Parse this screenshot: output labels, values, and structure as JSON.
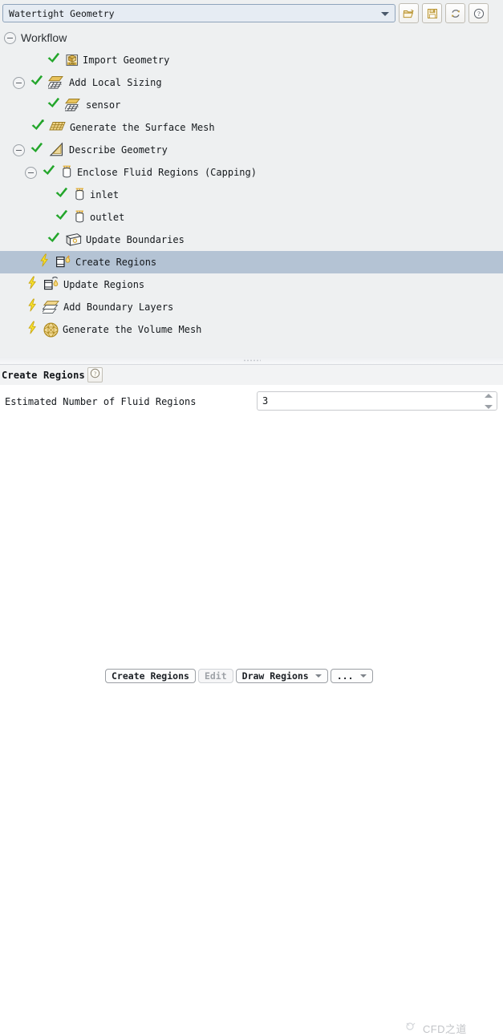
{
  "topbar": {
    "workflow_select": {
      "value": "Watertight Geometry",
      "caret_icon": "chevron-down-icon"
    },
    "buttons": [
      {
        "name": "open-workflow-button",
        "icon": "folder-open-icon",
        "tooltip": "Load Workflow"
      },
      {
        "name": "save-workflow-button",
        "icon": "floppy-disk-save-icon",
        "tooltip": "Save Workflow"
      },
      {
        "name": "reset-workflow-button",
        "icon": "refresh-circular-arrows-icon",
        "tooltip": "Reset Workflow"
      },
      {
        "name": "help-workflow-button",
        "icon": "question-mark-help-icon",
        "tooltip": "Help"
      }
    ]
  },
  "tree": {
    "root_label": "Workflow",
    "root_expander": "collapse-minus-icon",
    "nodes": [
      {
        "label": "Import Geometry",
        "indent": 58,
        "state": "check",
        "icon": "cad-box-icon",
        "expander": false
      },
      {
        "label": "Add Local Sizing",
        "indent": 16,
        "state": "check",
        "icon": "local-sizing-mesh-icon",
        "expander": true
      },
      {
        "label": "sensor",
        "indent": 58,
        "state": "check",
        "icon": "local-sizing-mesh-icon",
        "expander": false
      },
      {
        "label": "Generate the Surface Mesh",
        "indent": 38,
        "state": "check-new",
        "icon": "surface-mesh-icon",
        "expander": false
      },
      {
        "label": "Describe Geometry",
        "indent": 16,
        "state": "check",
        "icon": "triangle-ruler-icon",
        "expander": true
      },
      {
        "label": "Enclose Fluid Regions (Capping)",
        "indent": 31,
        "state": "check",
        "icon": "capping-cylinder-icon",
        "expander": true
      },
      {
        "label": "inlet",
        "indent": 68,
        "state": "check",
        "icon": "capping-cylinder-icon",
        "expander": false
      },
      {
        "label": "outlet",
        "indent": 68,
        "state": "check",
        "icon": "capping-cylinder-icon",
        "expander": false
      },
      {
        "label": "Update Boundaries",
        "indent": 58,
        "state": "check",
        "icon": "update-boundaries-icon",
        "expander": false
      },
      {
        "label": "Create Regions",
        "indent": 48,
        "state": "pending",
        "icon": "create-regions-icon",
        "expander": false,
        "selected": true
      },
      {
        "label": "Update Regions",
        "indent": 33,
        "state": "pending",
        "icon": "update-regions-icon",
        "expander": false
      },
      {
        "label": "Add Boundary Layers",
        "indent": 33,
        "state": "pending",
        "icon": "boundary-layers-icon",
        "expander": false
      },
      {
        "label": "Generate the Volume Mesh",
        "indent": 33,
        "state": "pending",
        "icon": "volume-mesh-sphere-icon",
        "expander": false
      }
    ]
  },
  "properties": {
    "title": "Create Regions",
    "help_icon": "question-mark-help-icon",
    "field_label": "Estimated Number of Fluid Regions",
    "field_value": "3",
    "spinner_up_icon": "spinner-up-arrow-icon",
    "spinner_down_icon": "spinner-down-arrow-icon"
  },
  "bottombar": {
    "buttons": [
      {
        "name": "create-regions-button",
        "label": "Create Regions",
        "disabled": false,
        "dropdown": false
      },
      {
        "name": "edit-button",
        "label": "Edit",
        "disabled": true,
        "dropdown": false
      },
      {
        "name": "draw-regions-button",
        "label": "Draw Regions",
        "disabled": false,
        "dropdown": true
      },
      {
        "name": "more-options-button",
        "label": "...",
        "disabled": false,
        "dropdown": true
      }
    ]
  },
  "watermark": {
    "text": "CFD之道",
    "icon": "cfd-logo-icon"
  },
  "colors": {
    "panel_bg": "#eef0f1",
    "selection": "#b4c3d4",
    "select_field": "#e6ecf3",
    "check_green": "#22a42a",
    "bolt_yellow": "#f7e12a",
    "accent_gold": "#d9b44a"
  }
}
